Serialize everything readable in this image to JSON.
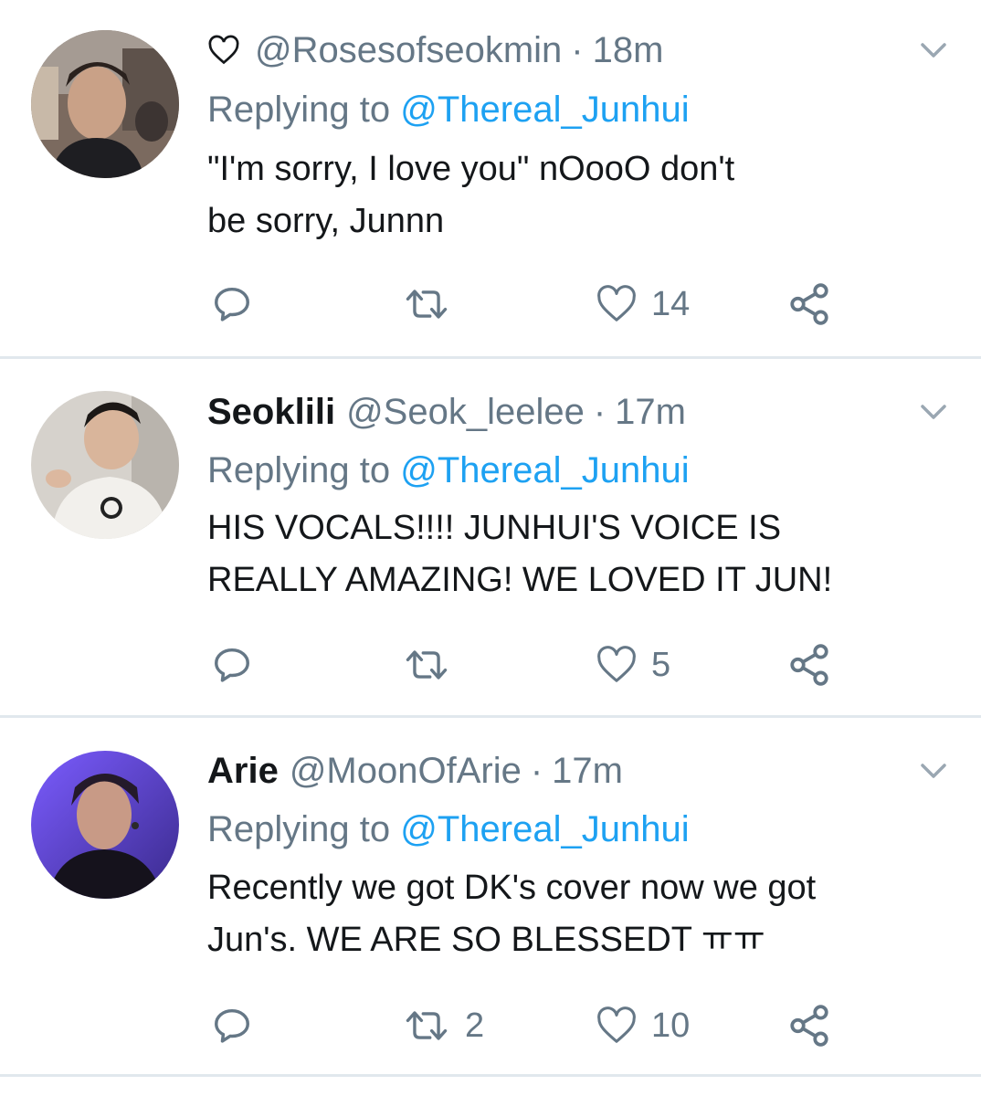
{
  "colors": {
    "accent": "#1da1f2",
    "muted": "#657786",
    "text": "#14171a",
    "divider": "#e1e8ed"
  },
  "tweets": [
    {
      "display_name": "",
      "handle": "@Rosesofseokmin",
      "separator": "·",
      "time": "18m",
      "replying_prefix": "Replying to",
      "replying_to": "@Thereal_Junhui",
      "text_lines": [
        "\"I'm sorry, I love you\" nOooO don't",
        "be sorry, Junnn"
      ],
      "retweets": "",
      "likes": "14",
      "icons": [
        "heart-outline-icon",
        "reply-icon",
        "retweet-icon",
        "like-icon",
        "share-icon",
        "chevron-down-icon"
      ]
    },
    {
      "display_name": "Seoklili",
      "handle": "@Seok_leelee",
      "separator": "·",
      "time": "17m",
      "replying_prefix": "Replying to",
      "replying_to": "@Thereal_Junhui",
      "text_lines": [
        "HIS VOCALS!!!! JUNHUI'S VOICE IS",
        "REALLY AMAZING! WE LOVED IT JUN!"
      ],
      "retweets": "",
      "likes": "5"
    },
    {
      "display_name": "Arie",
      "handle": "@MoonOfArie",
      "separator": "·",
      "time": "17m",
      "replying_prefix": "Replying to",
      "replying_to": "@Thereal_Junhui",
      "text_lines": [
        "Recently we got DK's cover now we got",
        "Jun's. WE ARE SO BLESSEDT ㅠㅠ"
      ],
      "retweets": "2",
      "likes": "10"
    }
  ]
}
